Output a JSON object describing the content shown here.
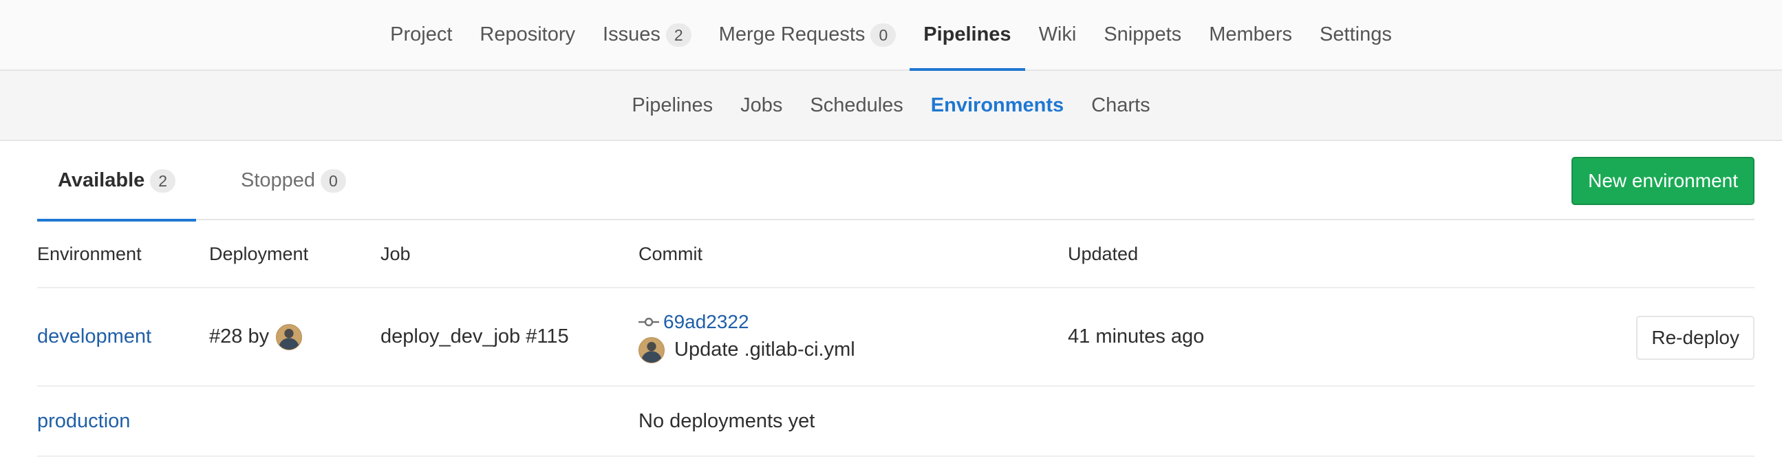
{
  "top_nav": {
    "items": [
      {
        "label": "Project"
      },
      {
        "label": "Repository"
      },
      {
        "label": "Issues",
        "count": "2"
      },
      {
        "label": "Merge Requests",
        "count": "0"
      },
      {
        "label": "Pipelines",
        "active": true
      },
      {
        "label": "Wiki"
      },
      {
        "label": "Snippets"
      },
      {
        "label": "Members"
      },
      {
        "label": "Settings"
      }
    ]
  },
  "sub_nav": {
    "items": [
      {
        "label": "Pipelines"
      },
      {
        "label": "Jobs"
      },
      {
        "label": "Schedules"
      },
      {
        "label": "Environments",
        "active": true
      },
      {
        "label": "Charts"
      }
    ]
  },
  "tabs": {
    "available": {
      "label": "Available",
      "count": "2"
    },
    "stopped": {
      "label": "Stopped",
      "count": "0"
    }
  },
  "new_environment_label": "New environment",
  "table": {
    "headers": [
      "Environment",
      "Deployment",
      "Job",
      "Commit",
      "Updated"
    ],
    "rows": [
      {
        "environment": "development",
        "deployment": "#28 by",
        "job": "deploy_dev_job #115",
        "commit_sha": "69ad2322",
        "commit_message": "Update .gitlab-ci.yml",
        "updated": "41 minutes ago",
        "action_label": "Re-deploy"
      },
      {
        "environment": "production",
        "no_deployments": "No deployments yet"
      }
    ]
  },
  "colors": {
    "accent": "#1f78d1",
    "link": "#1f5fa8",
    "success_button": "#1aaa55"
  }
}
